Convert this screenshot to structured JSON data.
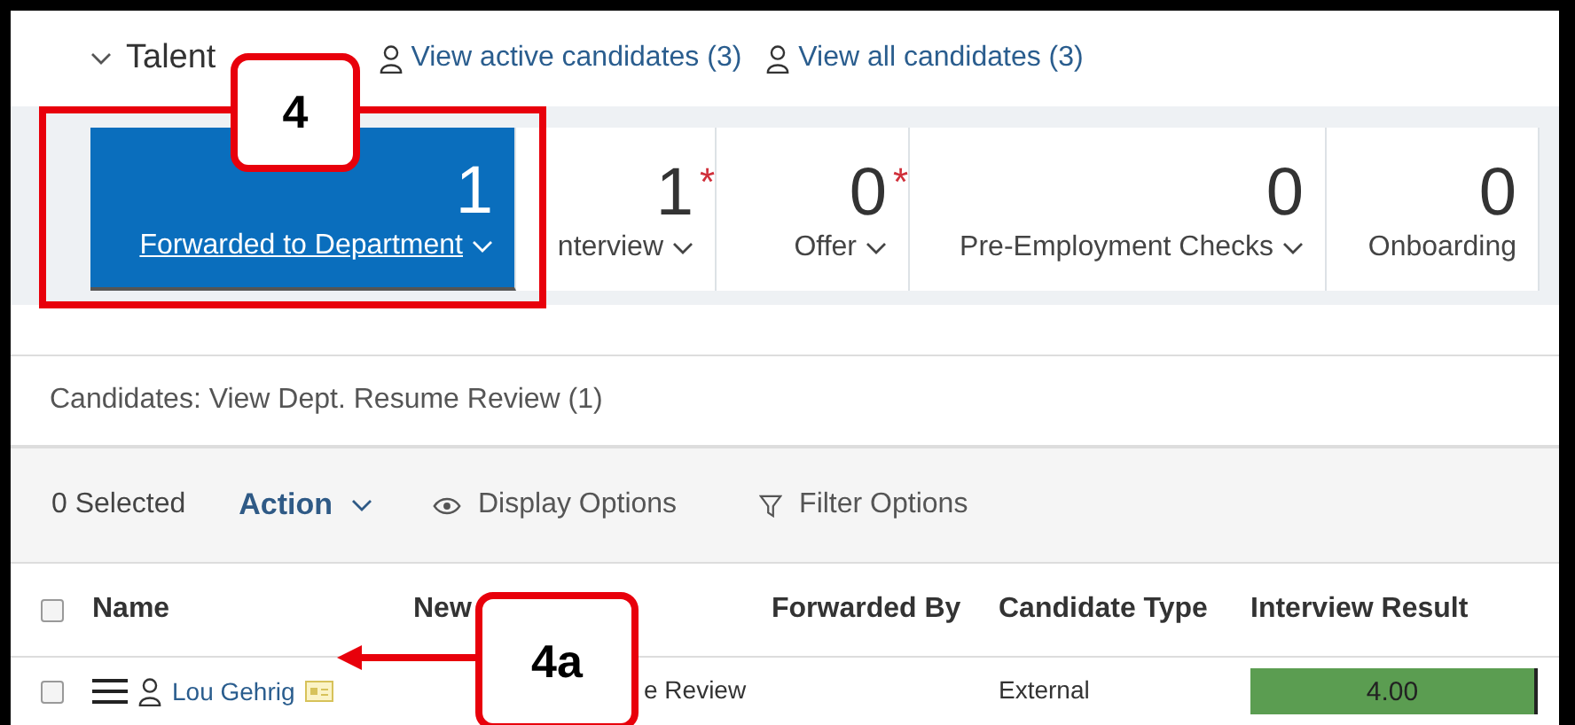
{
  "header": {
    "title": "Talent",
    "links": [
      {
        "label": "View active candidates (3)"
      },
      {
        "label": "View all candidates (3)"
      }
    ]
  },
  "tiles": [
    {
      "count": "1",
      "label": "Forwarded to Department",
      "dropdown": true,
      "selected": true
    },
    {
      "count": "1",
      "marker": "*",
      "label": "nterview",
      "dropdown": true,
      "selected": false
    },
    {
      "count": "0",
      "marker": "*",
      "label": "Offer",
      "dropdown": true,
      "selected": false
    },
    {
      "count": "0",
      "label": "Pre-Employment Checks",
      "dropdown": true,
      "selected": false
    },
    {
      "count": "0",
      "label": "Onboarding",
      "dropdown": false,
      "selected": false
    }
  ],
  "list_title": "Candidates: View Dept. Resume Review (1)",
  "toolbar": {
    "selected_count": "0 Selected",
    "action": "Action",
    "display_options": "Display Options",
    "filter_options": "Filter Options"
  },
  "table": {
    "select_all_checked": false,
    "columns": [
      "Name",
      "New",
      "Forwarded By",
      "Candidate Type",
      "Interview Result"
    ],
    "rows": [
      {
        "checked": false,
        "name": "Lou Gehrig",
        "status": "e Review",
        "candidate_type": "External",
        "interview_result": {
          "text": "4.00",
          "color": "#5b9d51"
        }
      }
    ]
  },
  "callouts": [
    {
      "label": "4",
      "kind": "frame"
    },
    {
      "label": "4a",
      "kind": "arrow"
    }
  ]
}
